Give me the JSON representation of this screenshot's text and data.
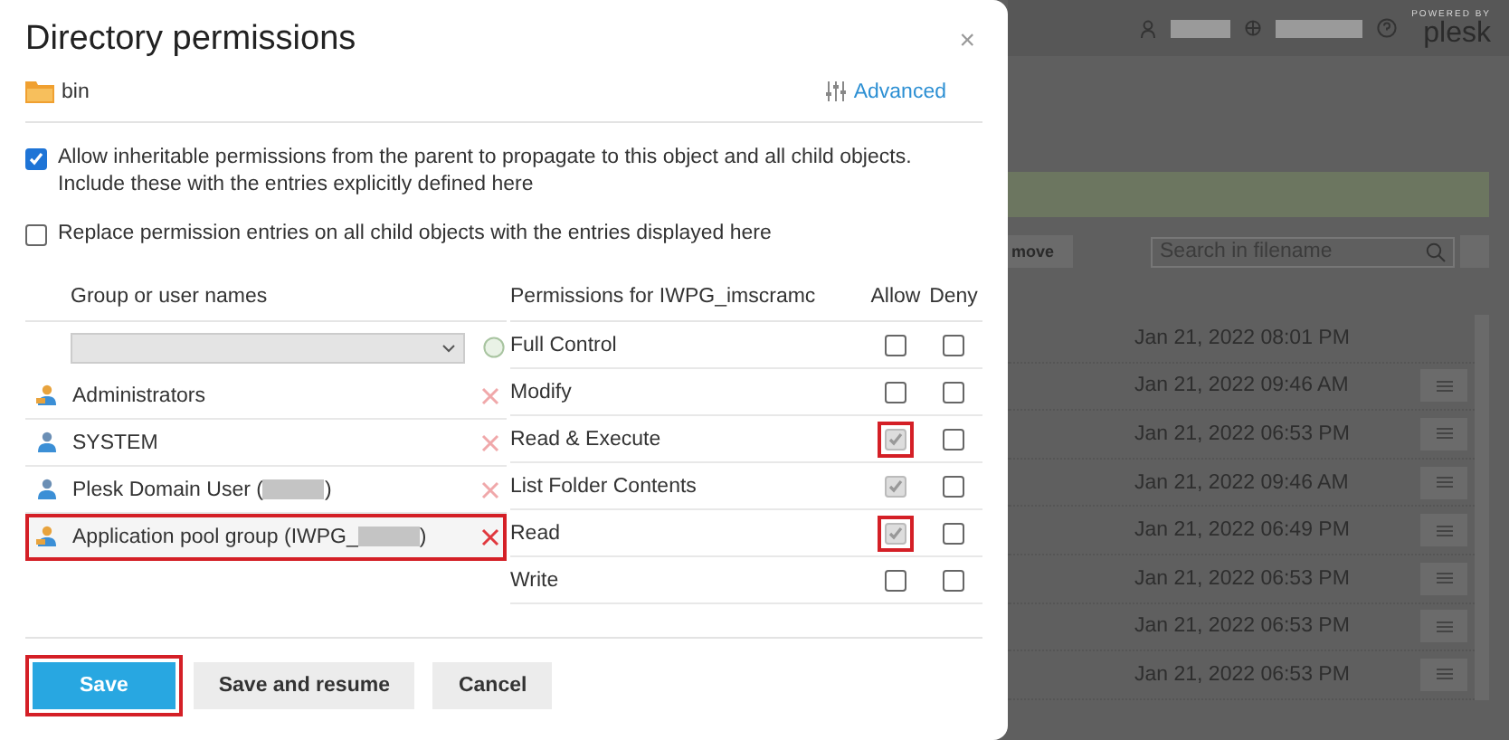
{
  "dialog": {
    "title": "Directory permissions",
    "close": "×",
    "folder": "bin",
    "advanced_link": "Advanced",
    "options": [
      {
        "label": "Allow inheritable permissions from the parent to propagate to this object and all child objects. Include these with the entries explicitly defined here",
        "checked": true
      },
      {
        "label": "Replace permission entries on all child objects with the entries displayed here",
        "checked": false
      }
    ],
    "users": {
      "heading": "Group or user names",
      "rows": [
        {
          "name": "Administrators",
          "kind": "group",
          "redacted": false,
          "selected": false
        },
        {
          "name": "SYSTEM",
          "kind": "user",
          "redacted": false,
          "selected": false
        },
        {
          "name": "Plesk Domain User (",
          "suffix": ")",
          "kind": "user",
          "redacted": true,
          "selected": false
        },
        {
          "name": "Application pool group (IWPG_",
          "suffix": ")",
          "kind": "group",
          "redacted": true,
          "selected": true
        }
      ]
    },
    "permissions": {
      "heading": "Permissions for IWPG_imscramc",
      "allow_label": "Allow",
      "deny_label": "Deny",
      "rows": [
        {
          "name": "Full Control",
          "allow": {
            "checked": false,
            "disabled": false,
            "highlighted": false
          },
          "deny": {
            "checked": false
          }
        },
        {
          "name": "Modify",
          "allow": {
            "checked": false,
            "disabled": false,
            "highlighted": false
          },
          "deny": {
            "checked": false
          }
        },
        {
          "name": "Read & Execute",
          "allow": {
            "checked": true,
            "disabled": true,
            "highlighted": true
          },
          "deny": {
            "checked": false
          }
        },
        {
          "name": "List Folder Contents",
          "allow": {
            "checked": true,
            "disabled": true,
            "highlighted": false
          },
          "deny": {
            "checked": false
          }
        },
        {
          "name": "Read",
          "allow": {
            "checked": true,
            "disabled": true,
            "highlighted": true
          },
          "deny": {
            "checked": false
          }
        },
        {
          "name": "Write",
          "allow": {
            "checked": false,
            "disabled": false,
            "highlighted": false
          },
          "deny": {
            "checked": false
          }
        }
      ]
    },
    "buttons": [
      {
        "label": "Save",
        "kind": "primary",
        "highlighted": true
      },
      {
        "label": "Save and resume",
        "kind": "secondary",
        "highlighted": false
      },
      {
        "label": "Cancel",
        "kind": "secondary",
        "highlighted": false
      }
    ]
  },
  "background": {
    "brand_tagline": "POWERED BY",
    "brand": "plesk",
    "remove_button": "move",
    "search_placeholder": "Search in filename",
    "rows": [
      {
        "date": "Jan 21, 2022 08:01 PM",
        "menu": false
      },
      {
        "date": "Jan 21, 2022 09:46 AM",
        "menu": true
      },
      {
        "date": "Jan 21, 2022 06:53 PM",
        "menu": true
      },
      {
        "date": "Jan 21, 2022 09:46 AM",
        "menu": true
      },
      {
        "date": "Jan 21, 2022 06:49 PM",
        "menu": true
      },
      {
        "date": "Jan 21, 2022 06:53 PM",
        "menu": true
      },
      {
        "date": "Jan 21, 2022 06:53 PM",
        "menu": true
      },
      {
        "date": "Jan 21, 2022 06:53 PM",
        "menu": true
      }
    ]
  }
}
